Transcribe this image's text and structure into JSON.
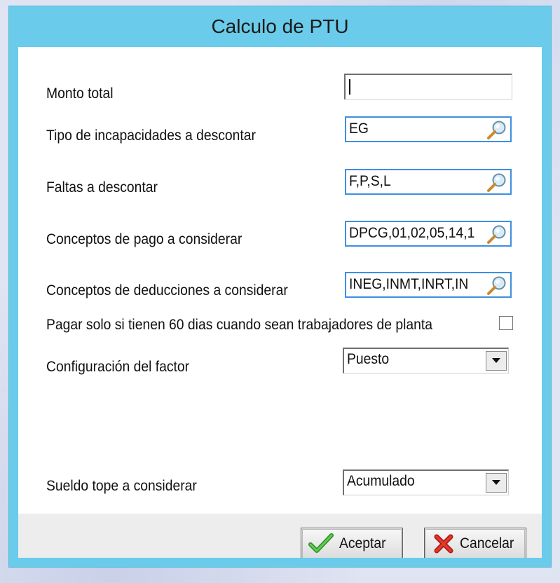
{
  "window": {
    "title": "Calculo de PTU"
  },
  "form": {
    "monto_total": {
      "label": "Monto total",
      "value": ""
    },
    "tipo_incapacidades": {
      "label": "Tipo de incapacidades a descontar",
      "value": "EG"
    },
    "faltas": {
      "label": "Faltas a descontar",
      "value": "F,P,S,L"
    },
    "conceptos_pago": {
      "label": "Conceptos de pago a considerar",
      "value": "DPCG,01,02,05,14,1"
    },
    "conceptos_deducciones": {
      "label": "Conceptos de deducciones a considerar",
      "value": "INEG,INMT,INRT,IN"
    },
    "pagar_60": {
      "label": "Pagar  solo si tienen 60 dias cuando sean trabajadores de planta",
      "checked": false
    },
    "factor": {
      "label": "Configuración del factor",
      "selected": "Puesto"
    },
    "sueldo_tope": {
      "label": "Sueldo tope a considerar",
      "selected": "Acumulado"
    }
  },
  "buttons": {
    "accept": "Aceptar",
    "cancel": "Cancelar"
  },
  "icons": {
    "lookup": "magnifier-icon",
    "dropdown": "dropdown-arrow-icon",
    "accept": "green-check-icon",
    "cancel": "red-x-icon"
  },
  "colors": {
    "titlebar": "#6acbea",
    "focus_border": "#3d8fe0"
  }
}
